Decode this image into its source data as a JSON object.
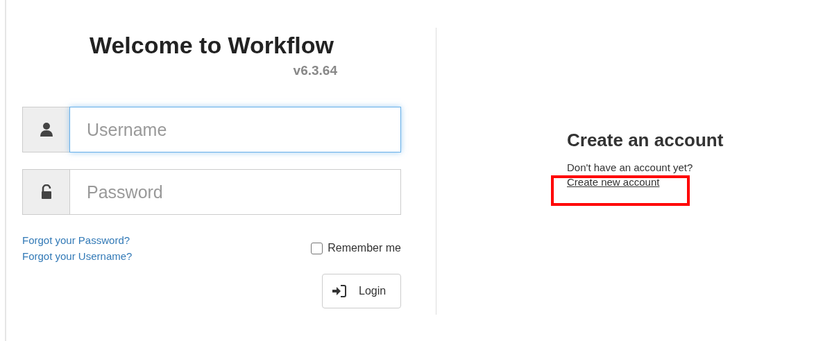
{
  "login": {
    "title": "Welcome to Workflow",
    "version": "v6.3.64",
    "username": {
      "placeholder": "Username",
      "focused": true
    },
    "password": {
      "placeholder": "Password",
      "focused": false
    },
    "links": [
      "Forgot your Password?",
      "Forgot your Username?"
    ],
    "remember": {
      "label": "Remember me",
      "checked": false
    },
    "button": "Login"
  },
  "signup": {
    "title": "Create an account",
    "text": "Don't have an account yet?",
    "link": "Create new account",
    "highlighted": true
  }
}
